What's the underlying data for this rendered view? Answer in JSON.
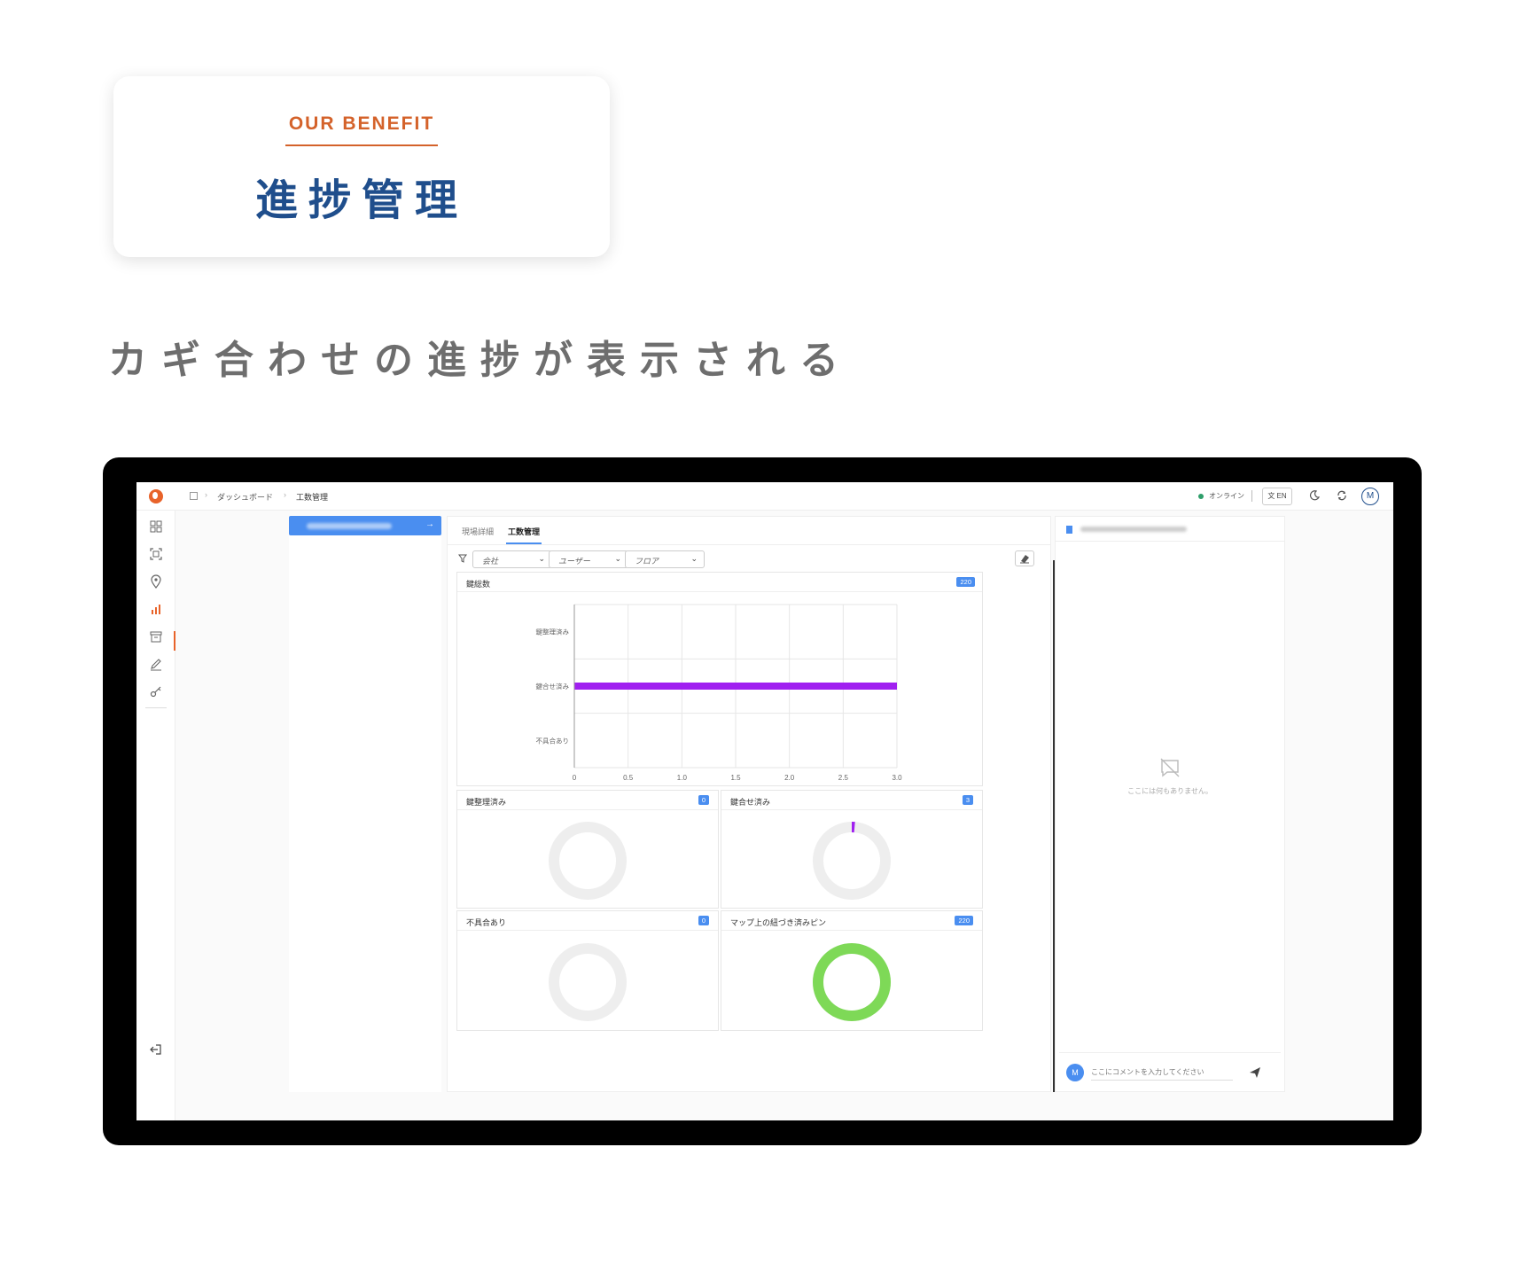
{
  "marketing": {
    "eyebrow": "OUR BENEFIT",
    "title": "進捗管理",
    "subheadline": "カギ合わせの進捗が表示される"
  },
  "topbar": {
    "breadcrumb": [
      "ダッシュボード",
      "工数管理"
    ],
    "status": "オンライン",
    "lang": "EN",
    "avatar": "M"
  },
  "rail": {
    "icons": [
      "dashboard-icon",
      "scan-icon",
      "location-icon",
      "chart-icon",
      "archive-icon",
      "edit-icon",
      "key-icon"
    ],
    "logout_icon": "logout-icon",
    "active_index": 3
  },
  "tabs": [
    "現場詳細",
    "工数管理"
  ],
  "filters": [
    "会社",
    "ユーザー",
    "フロア"
  ],
  "colors": {
    "accent": "#4a8ef0",
    "brand": "#e8632a",
    "bar": "#a020f0",
    "donut_track": "#eeeeee",
    "donut_complete": "#7ed957",
    "donut_progress": "#a020f0"
  },
  "chart_data": [
    {
      "type": "bar",
      "orientation": "horizontal",
      "title": "鍵総数",
      "badge": "220",
      "categories": [
        "鍵整理済み",
        "鍵合せ済み",
        "不具合あり"
      ],
      "values": [
        0,
        3,
        0
      ],
      "xlim": [
        0,
        3
      ],
      "x_ticks": [
        "0",
        "0.5",
        "1.0",
        "1.5",
        "2.0",
        "2.5",
        "3.0"
      ],
      "grid": true
    },
    {
      "type": "pie",
      "variant": "donut",
      "title": "鍵整理済み",
      "badge": "0",
      "value": 0,
      "total": 220
    },
    {
      "type": "pie",
      "variant": "donut",
      "title": "鍵合せ済み",
      "badge": "3",
      "value": 3,
      "total": 220
    },
    {
      "type": "pie",
      "variant": "donut",
      "title": "不具合あり",
      "badge": "0",
      "value": 0,
      "total": 220
    },
    {
      "type": "pie",
      "variant": "donut",
      "title": "マップ上の紐づき済みピン",
      "badge": "220",
      "value": 220,
      "total": 220
    }
  ],
  "comments": {
    "empty_text": "ここには何もありません。",
    "placeholder": "ここにコメントを入力してください",
    "avatar": "M"
  }
}
